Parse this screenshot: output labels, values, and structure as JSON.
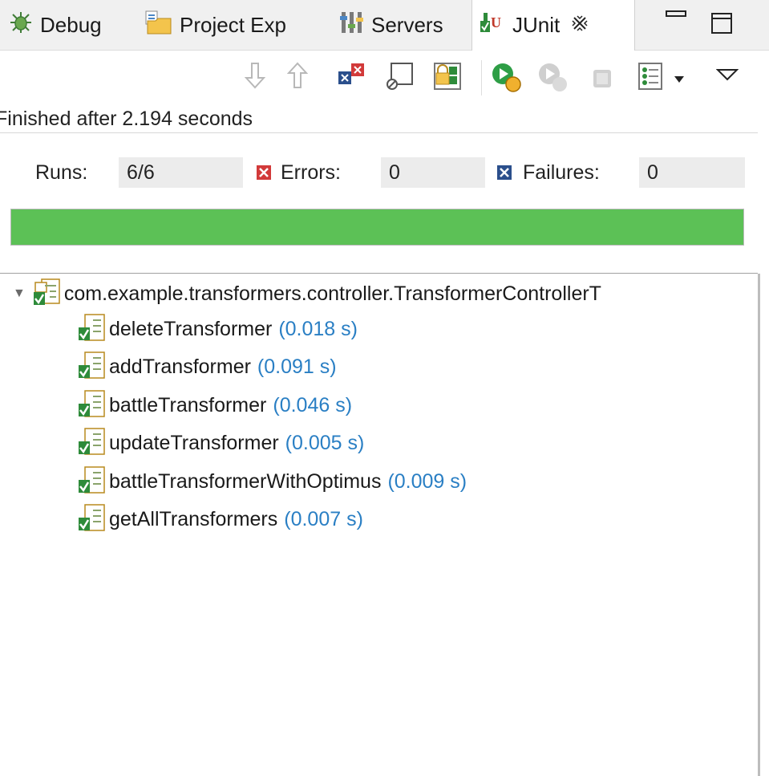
{
  "tabs": {
    "debug": "Debug",
    "project_explorer": "Project Exp",
    "servers": "Servers",
    "junit": "JUnit"
  },
  "status": {
    "finished": "Finished after 2.194 seconds"
  },
  "counters": {
    "runs_label": "Runs:",
    "runs_value": "6/6",
    "errors_label": "Errors:",
    "errors_value": "0",
    "failures_label": "Failures:",
    "failures_value": "0"
  },
  "progress": {
    "fraction": 1.0,
    "color": "#5cc156"
  },
  "tree": {
    "root_label": "com.example.transformers.controller.TransformerControllerT",
    "items": [
      {
        "name": "deleteTransformer",
        "time": "(0.018 s)"
      },
      {
        "name": "addTransformer",
        "time": "(0.091 s)"
      },
      {
        "name": "battleTransformer",
        "time": "(0.046 s)"
      },
      {
        "name": "updateTransformer",
        "time": "(0.005 s)"
      },
      {
        "name": "battleTransformerWithOptimus",
        "time": "(0.009 s)"
      },
      {
        "name": "getAllTransformers",
        "time": "(0.007 s)"
      }
    ]
  },
  "colors": {
    "time_text": "#2a7fc4",
    "error_mark": "#d23a3a",
    "failure_mark": "#2b4f8c"
  }
}
